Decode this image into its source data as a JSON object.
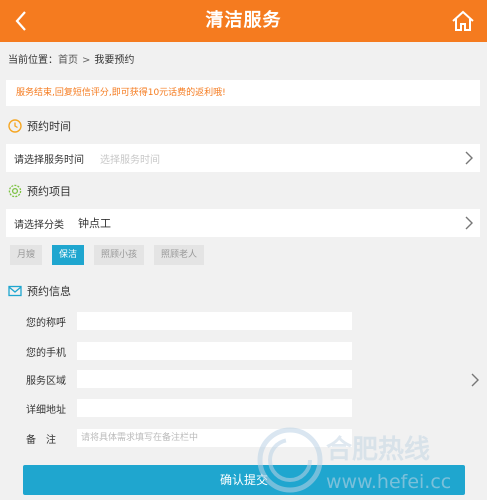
{
  "header": {
    "title": "清洁服务",
    "back_icon": "chevron-left-icon",
    "home_icon": "home-icon"
  },
  "breadcrumb": {
    "prefix": "当前位置：",
    "home": "首页",
    "separator": ">",
    "current": "我要预约"
  },
  "notice": "服务结束,回复短信评分,即可获得10元话费的返利哦!",
  "time_section": {
    "title": "预约时间",
    "label": "请选择服务时间",
    "placeholder": "选择服务时间"
  },
  "item_section": {
    "title": "预约项目",
    "label": "请选择分类",
    "value": "钟点工",
    "tags": [
      "月嫂",
      "保洁",
      "照顾小孩",
      "照顾老人"
    ],
    "active_tag": "保洁"
  },
  "info_section": {
    "title": "预约信息",
    "fields": [
      {
        "label": "您的称呼",
        "placeholder": ""
      },
      {
        "label": "您的手机",
        "placeholder": ""
      },
      {
        "label": "服务区域",
        "placeholder": ""
      },
      {
        "label": "详细地址",
        "placeholder": ""
      },
      {
        "label": "备　注",
        "placeholder": "请将具体需求填写在备注栏中"
      }
    ]
  },
  "submit_label": "确认提交",
  "watermark": {
    "name": "合肥热线",
    "url": "www.hefei.cc"
  },
  "colors": {
    "header": "#f57b1f",
    "accent": "#1fa6cf",
    "notice": "#f57b1f",
    "background": "#f1f1f1"
  }
}
